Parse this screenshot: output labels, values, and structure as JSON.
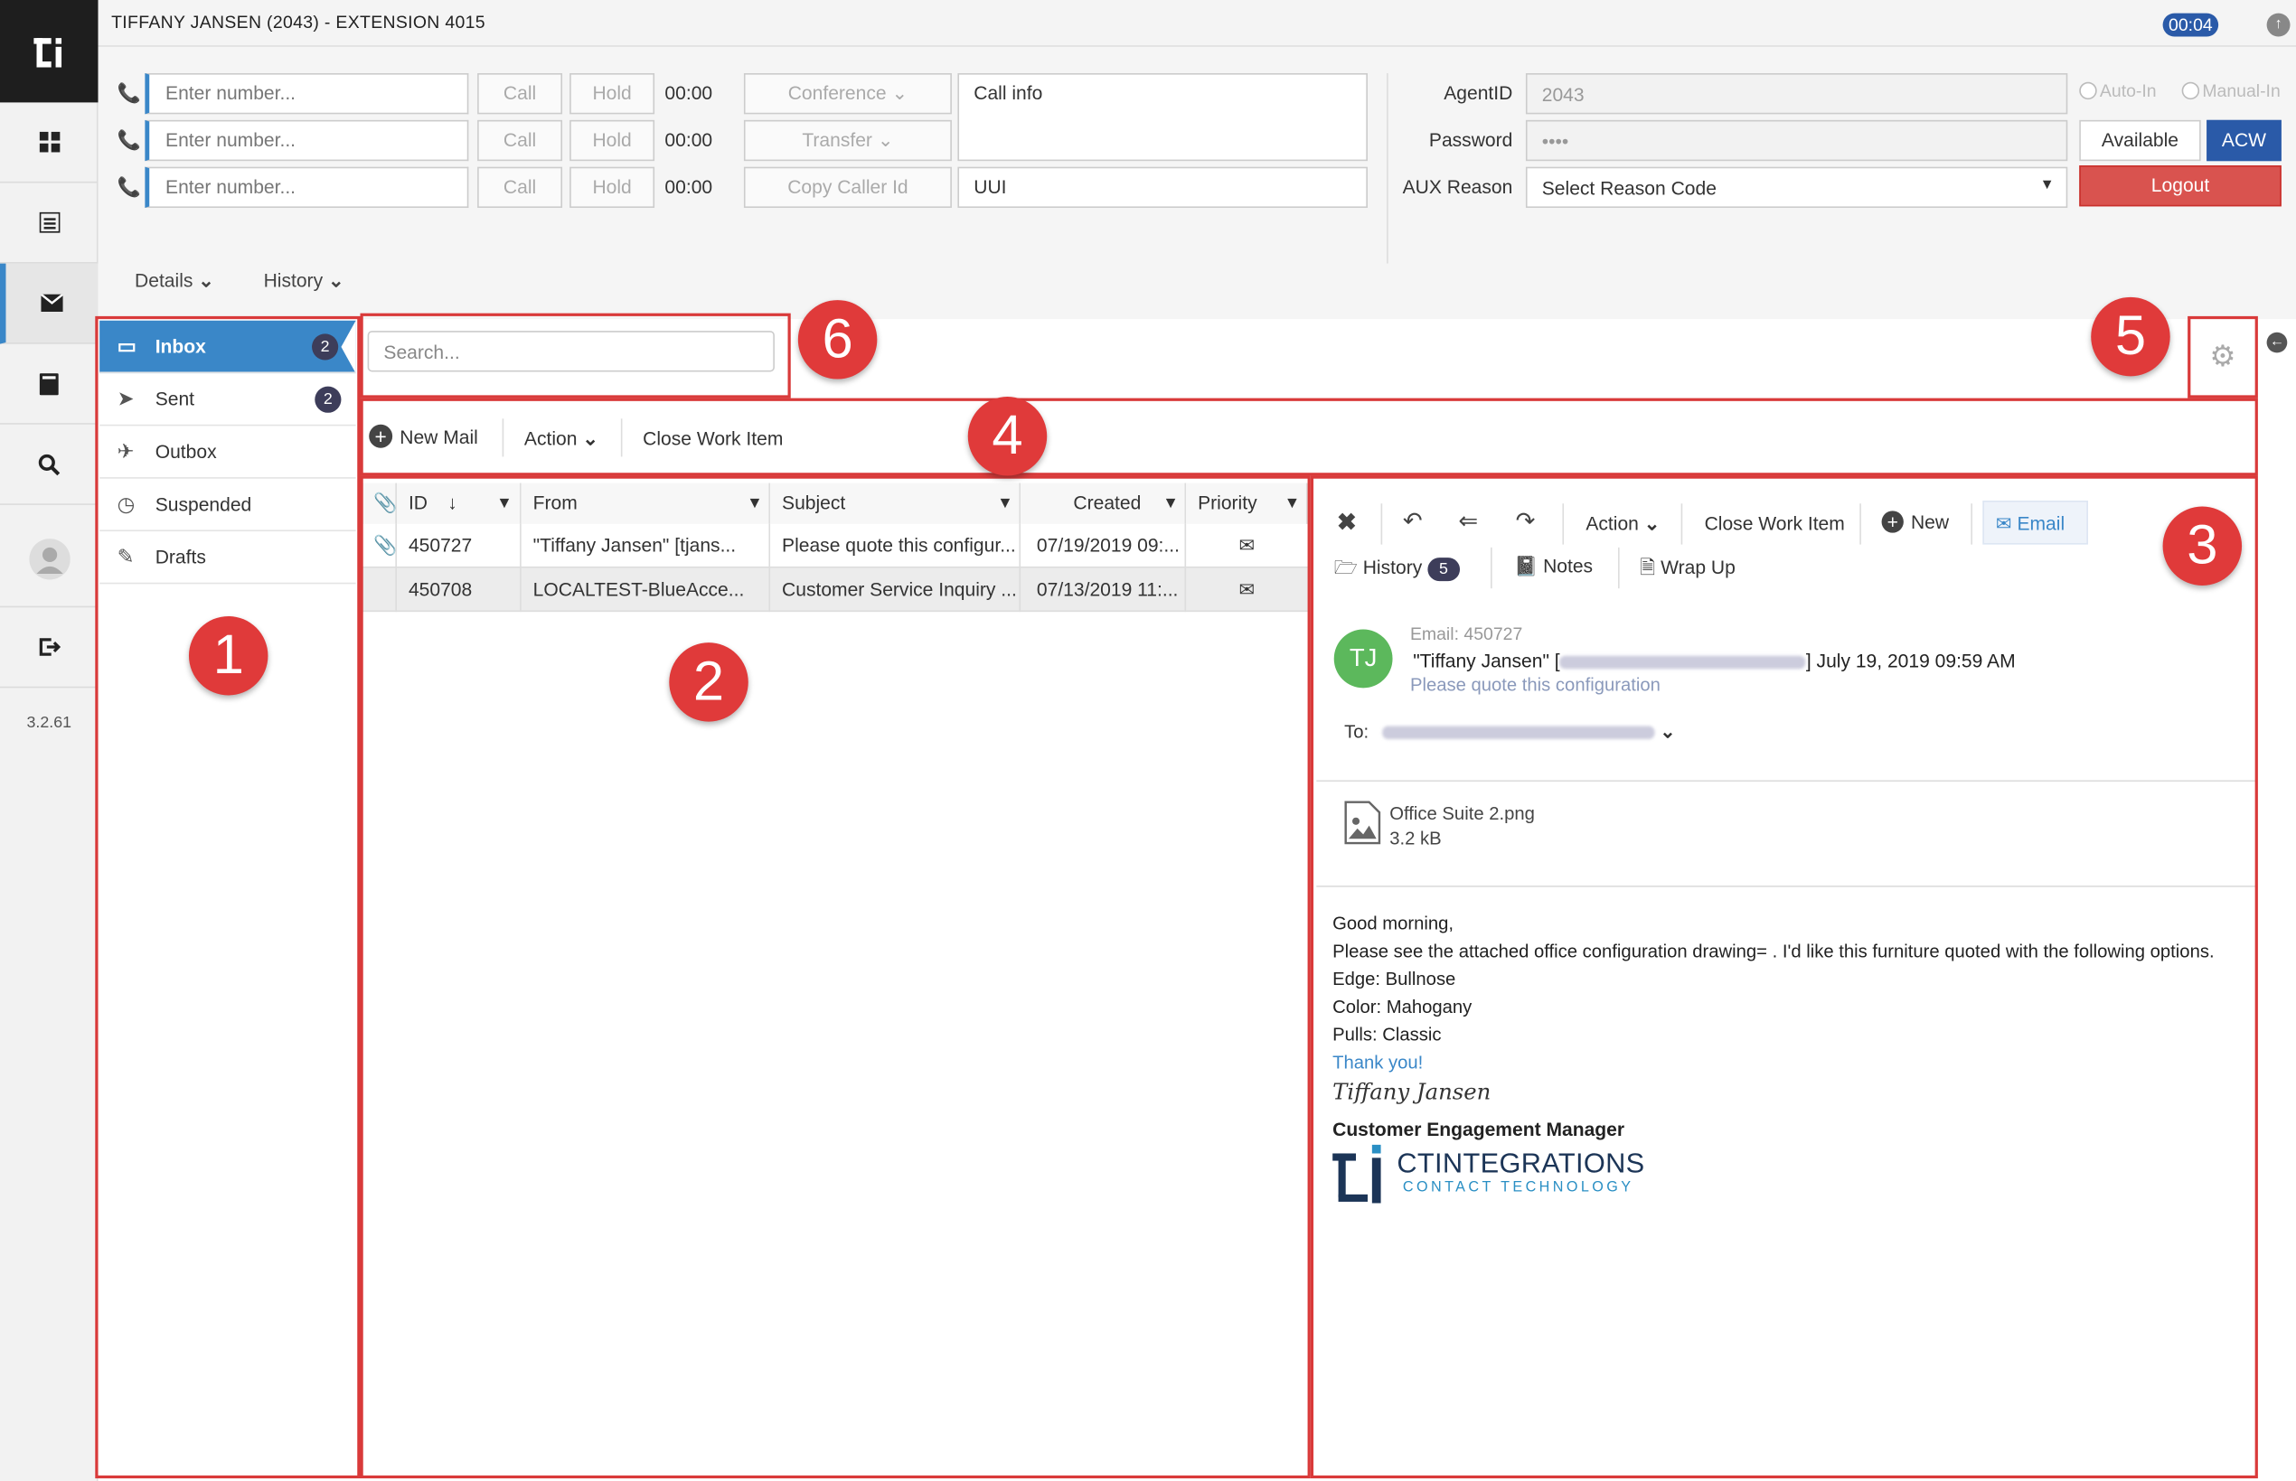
{
  "app": {
    "title": "TIFFANY JANSEN (2043) - EXTENSION 4015",
    "timer": "00:04",
    "version": "3.2.61"
  },
  "nav": {
    "items": [
      "dashboard-icon",
      "list-icon",
      "envelope-icon",
      "book-icon",
      "search-icon",
      "user-icon",
      "logout-icon"
    ]
  },
  "phone": {
    "lines": [
      {
        "placeholder": "Enter number...",
        "call": "Call",
        "hold": "Hold",
        "time": "00:00"
      },
      {
        "placeholder": "Enter number...",
        "call": "Call",
        "hold": "Hold",
        "time": "00:00"
      },
      {
        "placeholder": "Enter number...",
        "call": "Call",
        "hold": "Hold",
        "time": "00:00"
      }
    ],
    "conference": "Conference",
    "transfer": "Transfer",
    "copy_caller_id": "Copy Caller Id",
    "call_info": "Call info",
    "uui": "UUI"
  },
  "agent": {
    "agent_id_label": "AgentID",
    "agent_id_value": "2043",
    "password_label": "Password",
    "password_value": "••••",
    "aux_label": "AUX Reason",
    "aux_value": "Select Reason Code",
    "auto_in": "Auto-In",
    "manual_in": "Manual-In",
    "available": "Available",
    "acw": "ACW",
    "logout": "Logout"
  },
  "tabs": {
    "details": "Details",
    "history": "History"
  },
  "folders": [
    {
      "label": "Inbox",
      "badge": "2",
      "icon": "inbox-icon"
    },
    {
      "label": "Sent",
      "badge": "2",
      "icon": "send-icon"
    },
    {
      "label": "Outbox",
      "badge": "",
      "icon": "paper-plane-icon"
    },
    {
      "label": "Suspended",
      "badge": "",
      "icon": "clock-icon"
    },
    {
      "label": "Drafts",
      "badge": "",
      "icon": "pencil-icon"
    }
  ],
  "search": {
    "placeholder": "Search..."
  },
  "toolbar": {
    "new_mail": "New Mail",
    "action": "Action",
    "close_work_item": "Close Work Item"
  },
  "table": {
    "columns": [
      "ID",
      "From",
      "Subject",
      "Created",
      "Priority"
    ],
    "rows": [
      {
        "attach": true,
        "id": "450727",
        "from": "\"Tiffany Jansen\" [tjans...",
        "subject": "Please quote this configur...",
        "created": "07/19/2019 09:...",
        "priority": "envelope-icon"
      },
      {
        "attach": false,
        "id": "450708",
        "from": "LOCALTEST-BlueAcce...",
        "subject": "Customer Service Inquiry ...",
        "created": "07/13/2019 11:...",
        "priority": "envelope-icon"
      }
    ]
  },
  "preview": {
    "toolbar": {
      "action": "Action",
      "close_work_item": "Close Work Item",
      "new": "New",
      "email": "Email",
      "history": "History",
      "history_count": "5",
      "notes": "Notes",
      "wrap_up": "Wrap Up"
    },
    "email": {
      "avatar_initials": "TJ",
      "label": "Email:",
      "id": "450727",
      "from_name": "\"Tiffany Jansen\"",
      "date": "July 19, 2019 09:59 AM",
      "subject": "Please quote this configuration",
      "to_label": "To:",
      "attachment_name": "Office Suite 2.png",
      "attachment_size": "3.2 kB",
      "body": [
        "Good morning,",
        "Please see the attached office configuration drawing= . I'd like this furniture quoted with the following options.",
        "Edge: Bullnose",
        "Color: Mahogany",
        "Pulls: Classic"
      ],
      "thanks": "Thank you!",
      "signature": "Tiffany Jansen",
      "sig_title": "Customer Engagement Manager",
      "logo_line1": "CTINTEGRATIONS",
      "logo_line2": "CONTACT TECHNOLOGY"
    }
  },
  "callouts": [
    "1",
    "2",
    "3",
    "4",
    "5",
    "6"
  ],
  "colors": {
    "accent": "#3a87c8",
    "danger": "#d9534f",
    "callout": "#e03a3a",
    "acw": "#2a5aa8",
    "avatar": "#5cb85c"
  }
}
